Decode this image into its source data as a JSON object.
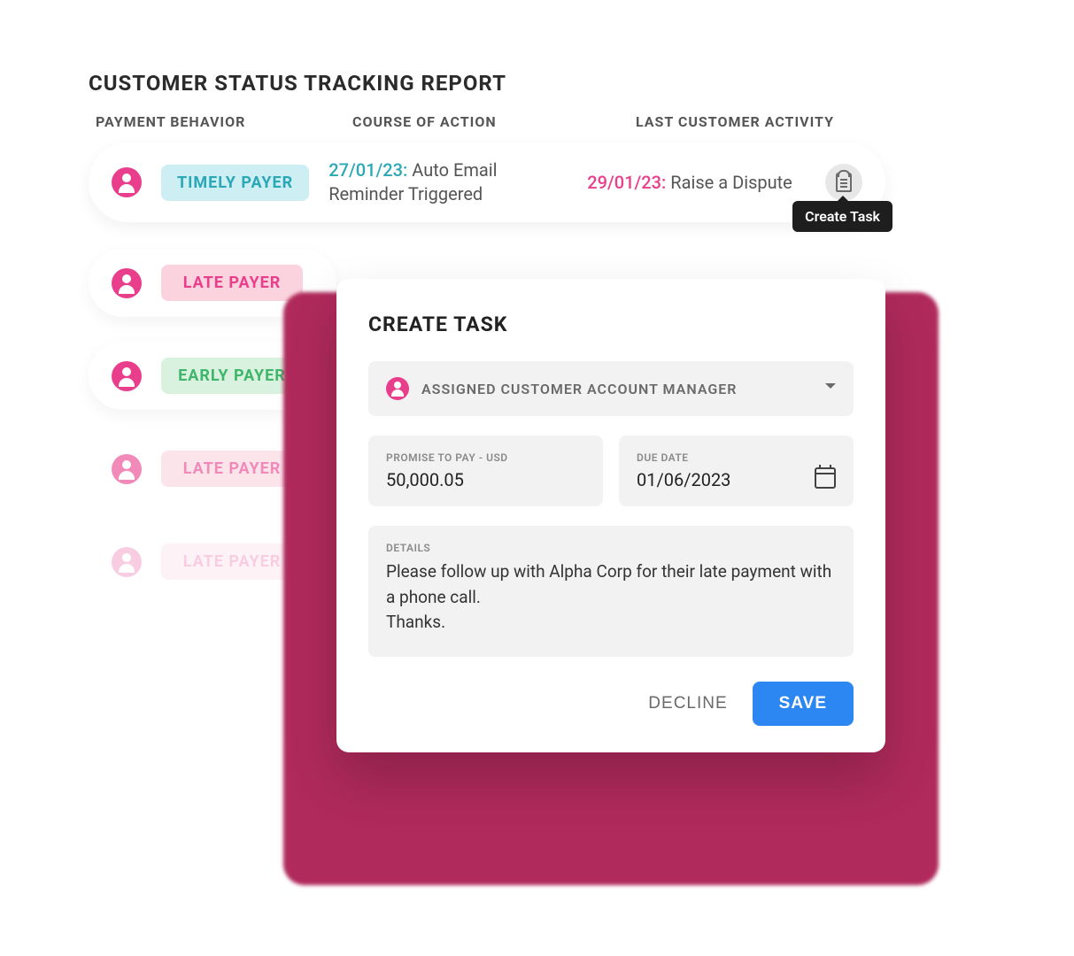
{
  "title": "CUSTOMER STATUS TRACKING REPORT",
  "columns": {
    "c1": "PAYMENT BEHAVIOR",
    "c2": "COURSE OF ACTION",
    "c3": "LAST CUSTOMER ACTIVITY"
  },
  "rows": [
    {
      "badge": "TIMELY PAYER",
      "badge_style": "teal",
      "action_date": "27/01/23:",
      "action_text": "Auto Email Reminder Triggered",
      "activity_date": "29/01/23:",
      "activity_text": "Raise a Dispute"
    },
    {
      "badge": "LATE PAYER",
      "badge_style": "pink"
    },
    {
      "badge": "EARLY PAYER",
      "badge_style": "green"
    },
    {
      "badge": "LATE PAYER",
      "badge_style": "pink"
    },
    {
      "badge": "LATE PAYER",
      "badge_style": "pink"
    }
  ],
  "tooltip": "Create Task",
  "modal": {
    "title": "CREATE TASK",
    "assignee_label": "ASSIGNED CUSTOMER ACCOUNT MANAGER",
    "amount_label": "PROMISE TO PAY - USD",
    "amount_value": "50,000.05",
    "due_label": "DUE DATE",
    "due_value": "01/06/2023",
    "details_label": "DETAILS",
    "details_text": "Please follow up with Alpha Corp for their late payment with a phone call.\nThanks.",
    "decline": "DECLINE",
    "save": "SAVE"
  }
}
